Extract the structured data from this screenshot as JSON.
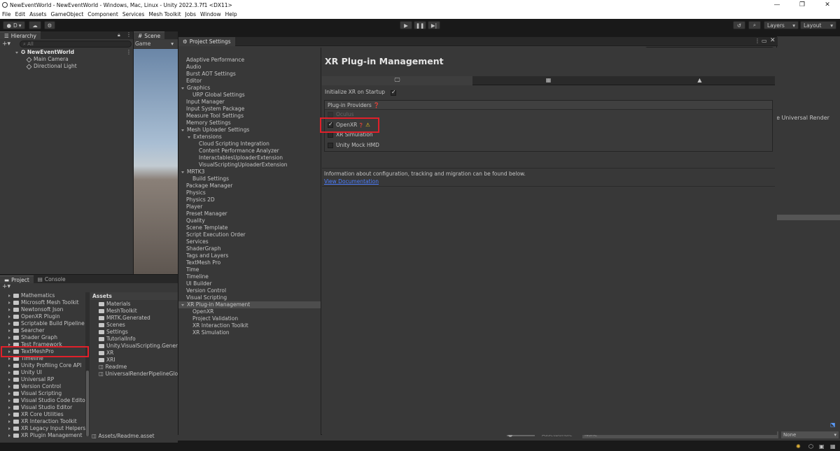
{
  "window": {
    "title": "NewEventWorld - NewEventWorld - Windows, Mac, Linux - Unity 2022.3.7f1 <DX11>",
    "minimize": "—",
    "restore": "❐",
    "close": "✕"
  },
  "menu": [
    "File",
    "Edit",
    "Assets",
    "GameObject",
    "Component",
    "Services",
    "Mesh Toolkit",
    "Jobs",
    "Window",
    "Help"
  ],
  "toolbar": {
    "account_label": "D",
    "layers_label": "Layers",
    "layout_label": "Layout"
  },
  "hierarchy": {
    "tab": "Hierarchy",
    "search_placeholder": "All",
    "scene": "NewEventWorld",
    "items": [
      "Main Camera",
      "Directional Light"
    ]
  },
  "scene_tabs": {
    "scene": "Scene",
    "game": "Game"
  },
  "project_panel": {
    "tabs": [
      "Project",
      "Console"
    ],
    "packages": [
      "Mathematics",
      "Microsoft Mesh Toolkit",
      "Newtonsoft Json",
      "OpenXR Plugin",
      "Scriptable Build Pipeline",
      "Searcher",
      "Shader Graph",
      "Test Framework",
      "TextMeshPro",
      "Timeline",
      "Unity Profiling Core API",
      "Unity UI",
      "Universal RP",
      "Version Control",
      "Visual Scripting",
      "Visual Studio Code Editor",
      "Visual Studio Editor",
      "XR Core Utilities",
      "XR Interaction Toolkit",
      "XR Legacy Input Helpers",
      "XR Plugin Management"
    ],
    "assets_header": "Assets",
    "assets": [
      "Materials",
      "MeshToolkit",
      "MRTK.Generated",
      "Scenes",
      "Settings",
      "TutorialInfo",
      "Unity.VisualScripting.Generated",
      "XR",
      "XRI",
      "Readme",
      "UniversalRenderPipelineGlobalSettings"
    ],
    "status_path": "Assets/Readme.asset"
  },
  "inspector": {
    "partial_text": "ne Universal Render",
    "assetbundle_label": "AssetBundle",
    "assetbundle_value": "None",
    "variant_value": "None"
  },
  "project_settings": {
    "title": "Project Settings",
    "nav": [
      {
        "label": "Adaptive Performance",
        "indent": 0
      },
      {
        "label": "Audio",
        "indent": 0
      },
      {
        "label": "Burst AOT Settings",
        "indent": 0
      },
      {
        "label": "Editor",
        "indent": 0
      },
      {
        "label": "Graphics",
        "indent": 0,
        "fold": "open"
      },
      {
        "label": "URP Global Settings",
        "indent": 1
      },
      {
        "label": "Input Manager",
        "indent": 0
      },
      {
        "label": "Input System Package",
        "indent": 0
      },
      {
        "label": "Measure Tool Settings",
        "indent": 0
      },
      {
        "label": "Memory Settings",
        "indent": 0
      },
      {
        "label": "Mesh Uploader Settings",
        "indent": 0,
        "fold": "open"
      },
      {
        "label": "Extensions",
        "indent": 1,
        "fold": "open"
      },
      {
        "label": "Cloud Scripting Integration",
        "indent": 2
      },
      {
        "label": "Content Performance Analyzer",
        "indent": 2
      },
      {
        "label": "InteractablesUploaderExtension",
        "indent": 2
      },
      {
        "label": "VisualScriptingUploaderExtension",
        "indent": 2
      },
      {
        "label": "MRTK3",
        "indent": 0,
        "fold": "open"
      },
      {
        "label": "Build Settings",
        "indent": 1
      },
      {
        "label": "Package Manager",
        "indent": 0
      },
      {
        "label": "Physics",
        "indent": 0
      },
      {
        "label": "Physics 2D",
        "indent": 0
      },
      {
        "label": "Player",
        "indent": 0
      },
      {
        "label": "Preset Manager",
        "indent": 0
      },
      {
        "label": "Quality",
        "indent": 0
      },
      {
        "label": "Scene Template",
        "indent": 0
      },
      {
        "label": "Script Execution Order",
        "indent": 0
      },
      {
        "label": "Services",
        "indent": 0
      },
      {
        "label": "ShaderGraph",
        "indent": 0
      },
      {
        "label": "Tags and Layers",
        "indent": 0
      },
      {
        "label": "TextMesh Pro",
        "indent": 0
      },
      {
        "label": "Time",
        "indent": 0
      },
      {
        "label": "Timeline",
        "indent": 0
      },
      {
        "label": "UI Builder",
        "indent": 0
      },
      {
        "label": "Version Control",
        "indent": 0
      },
      {
        "label": "Visual Scripting",
        "indent": 0
      },
      {
        "label": "XR Plug-in Management",
        "indent": 0,
        "fold": "open",
        "selected": true
      },
      {
        "label": "OpenXR",
        "indent": 1
      },
      {
        "label": "Project Validation",
        "indent": 1
      },
      {
        "label": "XR Interaction Toolkit",
        "indent": 1
      },
      {
        "label": "XR Simulation",
        "indent": 1
      }
    ],
    "page_title": "XR Plug-in Management",
    "initialize_label": "Initialize XR on Startup",
    "providers_header": "Plug-in Providers",
    "providers": [
      {
        "label": "Oculus",
        "checked": false,
        "disabled": true
      },
      {
        "label": "OpenXR",
        "checked": true,
        "disabled": false
      },
      {
        "label": "XR Simulation",
        "checked": false,
        "disabled": false
      },
      {
        "label": "Unity Mock HMD",
        "checked": false,
        "disabled": false
      }
    ],
    "info_text": "Information about configuration, tracking and migration can be found below.",
    "doc_link": "View Documentation"
  },
  "colors": {
    "highlight": "#e0202a",
    "link": "#4c7eff",
    "warning": "#f5c518"
  }
}
